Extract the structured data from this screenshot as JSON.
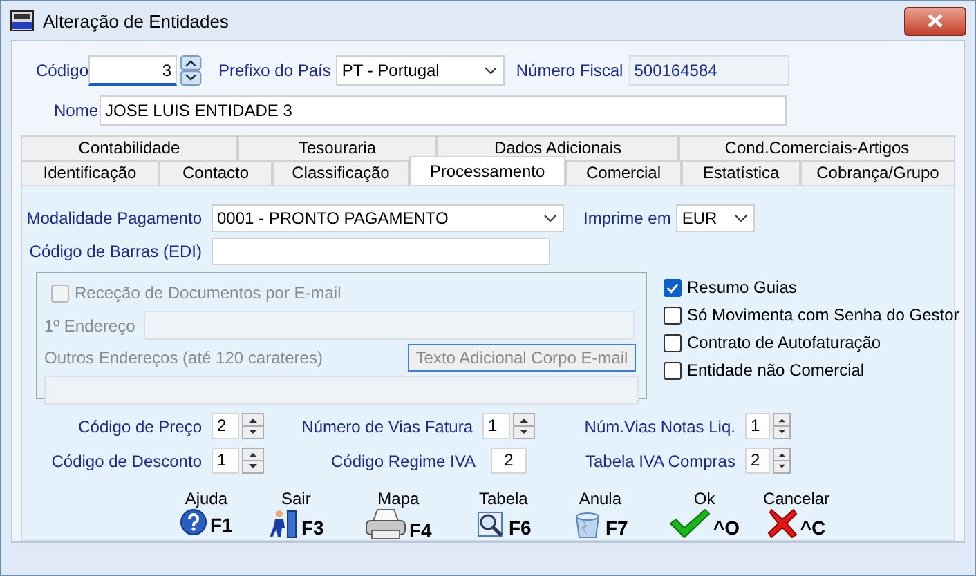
{
  "window": {
    "title": "Alteração de Entidades"
  },
  "header": {
    "codigo": {
      "label": "Código",
      "value": "3"
    },
    "prefixo": {
      "label": "Prefixo do País",
      "value": "PT - Portugal"
    },
    "numero_fiscal": {
      "label": "Número Fiscal",
      "value": "500164584"
    },
    "nome": {
      "label": "Nome",
      "value": "JOSE LUIS ENTIDADE 3"
    }
  },
  "tabs_row_1": [
    {
      "label": "Contabilidade",
      "selected": false
    },
    {
      "label": "Tesouraria",
      "selected": false
    },
    {
      "label": "Dados Adicionais",
      "selected": false
    },
    {
      "label": "Cond.Comerciais-Artigos",
      "selected": false
    }
  ],
  "tabs_row_2": [
    {
      "label": "Identificação",
      "selected": false
    },
    {
      "label": "Contacto",
      "selected": false
    },
    {
      "label": "Classificação",
      "selected": false
    },
    {
      "label": "Processamento",
      "selected": true
    },
    {
      "label": "Comercial",
      "selected": false
    },
    {
      "label": "Estatística",
      "selected": false
    },
    {
      "label": "Cobrança/Grupo",
      "selected": false
    }
  ],
  "processamento": {
    "modalidade": {
      "label": "Modalidade Pagamento",
      "value": "0001 - PRONTO PAGAMENTO"
    },
    "imprime": {
      "label": "Imprime em",
      "value": "EUR"
    },
    "codigo_barras": {
      "label": "Código de Barras (EDI)"
    },
    "email_group": {
      "checkbox": {
        "label": "Receção de Documentos por E-mail",
        "checked": false,
        "disabled": true
      },
      "endereco_label": "1º Endereço",
      "outros_label": "Outros Endereços (até 120 carateres)",
      "button": "Texto Adicional Corpo E-mail"
    },
    "options": [
      {
        "label": "Resumo Guias",
        "checked": true
      },
      {
        "label": "Só Movimenta com Senha do Gestor",
        "checked": false
      },
      {
        "label": "Contrato de Autofaturação",
        "checked": false
      },
      {
        "label": "Entidade não Comercial",
        "checked": false
      }
    ],
    "numeric_fields": [
      {
        "label": "Código de Preço",
        "value": "2",
        "kind": "spin"
      },
      {
        "label": "Número de Vias Fatura",
        "value": "1",
        "kind": "spin"
      },
      {
        "label": "Núm.Vias Notas Liq.",
        "value": "1",
        "kind": "spin"
      },
      {
        "label": "Código de Desconto",
        "value": "1",
        "kind": "spin"
      },
      {
        "label": "Código Regime IVA",
        "value": "2",
        "kind": "plain"
      },
      {
        "label": "Tabela IVA Compras",
        "value": "2",
        "kind": "spin"
      }
    ]
  },
  "toolbar": [
    {
      "label": "Ajuda",
      "key": "F1",
      "kind": "help"
    },
    {
      "label": "Sair",
      "key": "F3",
      "kind": "exit"
    },
    {
      "label": "Mapa",
      "key": "F4",
      "kind": "print"
    },
    {
      "label": "Tabela",
      "key": "F6",
      "kind": "lookup"
    },
    {
      "label": "Anula",
      "key": "F7",
      "kind": "bin"
    },
    {
      "label": "Ok",
      "key": "^O",
      "kind": "ok"
    },
    {
      "label": "Cancelar",
      "key": "^C",
      "kind": "cancel"
    }
  ]
}
